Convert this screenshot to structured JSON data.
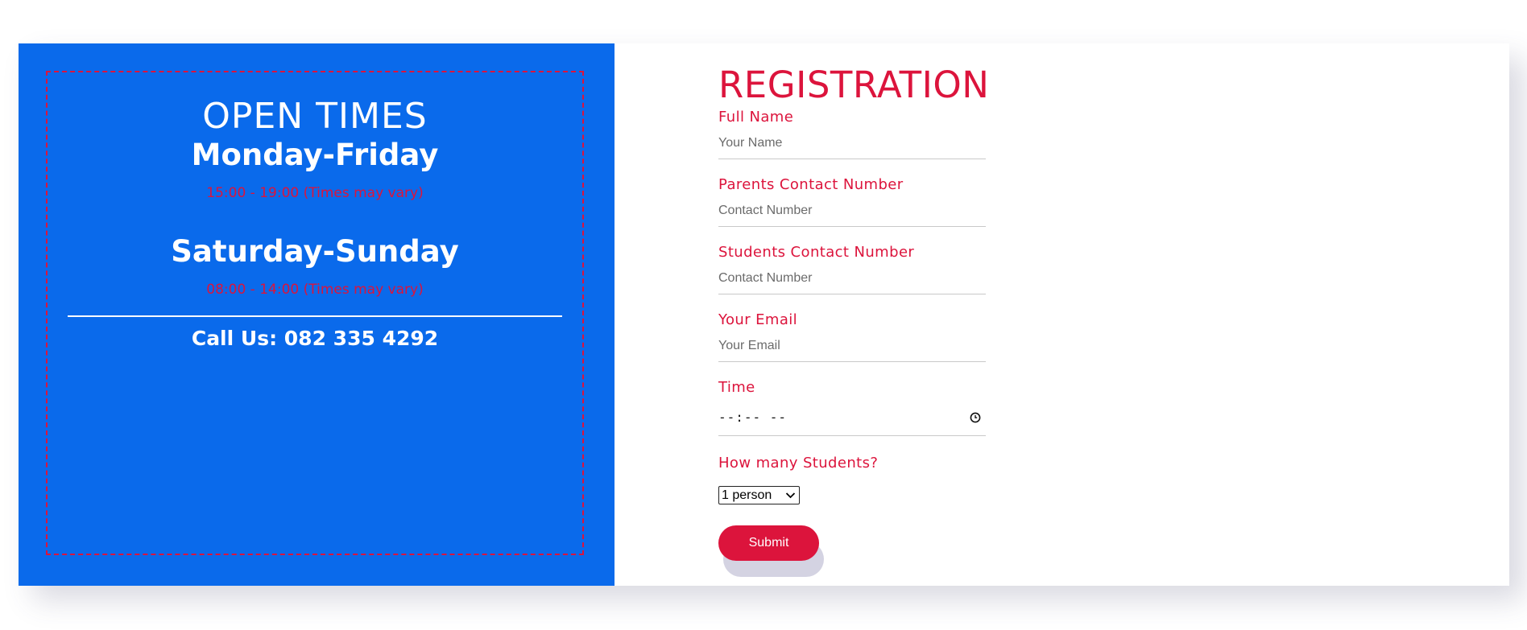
{
  "open_times": {
    "title": "OPEN TIMES",
    "weekday_title": "Monday-Friday",
    "weekday_hours": "15:00 - 19:00 (Times may vary)",
    "weekend_title": "Saturday-Sunday",
    "weekend_hours": "08:00 - 14:00 (Times may vary)",
    "call_us": "Call Us: 082 335 4292"
  },
  "registration": {
    "title": "REGISTRATION",
    "full_name": {
      "label": "Full Name",
      "placeholder": "Your Name",
      "value": ""
    },
    "parents_contact": {
      "label": "Parents Contact Number",
      "placeholder": "Contact Number",
      "value": ""
    },
    "students_contact": {
      "label": "Students Contact Number",
      "placeholder": "Contact Number",
      "value": ""
    },
    "email": {
      "label": "Your Email",
      "placeholder": "Your Email",
      "value": ""
    },
    "time": {
      "label": "Time",
      "value": "--:-- --",
      "icon": "clock-icon"
    },
    "students": {
      "label": "How many Students?",
      "selected": "1 person"
    },
    "submit_label": "Submit"
  },
  "colors": {
    "left_panel": "#0a6aeb",
    "accent": "#dc143c",
    "button_shadow": "#d4d3e2"
  }
}
